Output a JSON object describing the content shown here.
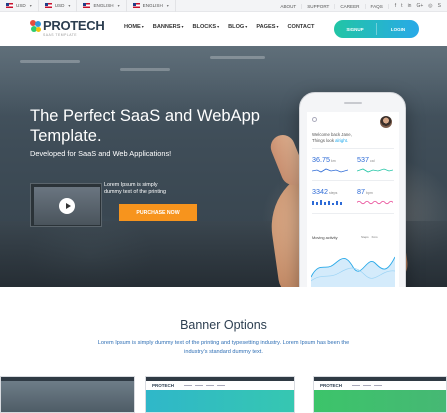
{
  "topbar": {
    "currency1": "USD",
    "currency2": "USD",
    "language1": "ENGLISH",
    "language2": "ENGLISH",
    "links": [
      "ABOUT",
      "SUPPORT",
      "CAREER",
      "FAQS"
    ],
    "social_icons": [
      "facebook-icon",
      "twitter-icon",
      "linkedin-icon",
      "google-plus-icon",
      "instagram-icon",
      "skype-icon"
    ]
  },
  "header": {
    "logo_text": "PROTECH",
    "logo_sub": "SAAS TEMPLATE",
    "nav": [
      {
        "label": "HOME",
        "dropdown": true
      },
      {
        "label": "BANNERS",
        "dropdown": true
      },
      {
        "label": "BLOCKS",
        "dropdown": true
      },
      {
        "label": "BLOG",
        "dropdown": true
      },
      {
        "label": "PAGES",
        "dropdown": true
      },
      {
        "label": "CONTACT",
        "dropdown": false
      }
    ],
    "signup_label": "SIGNUP",
    "login_label": "LOGIN"
  },
  "hero": {
    "title": "The Perfect SaaS and WebApp Template.",
    "subtitle": "Developed for SaaS and Web Applications!",
    "video_text": "Lorem Ipsum is simply dummy text of the printing",
    "purchase_label": "PURCHASE NOW"
  },
  "phone": {
    "welcome_line1": "Welcome back Jane,",
    "welcome_line2_prefix": "Things look ",
    "welcome_highlight": "alright.",
    "stats": [
      {
        "value": "36.75",
        "unit": "km",
        "color": "#2e6bd6"
      },
      {
        "value": "537",
        "unit": "cal",
        "color": "#2e6bd6"
      },
      {
        "value": "3342",
        "unit": "steps",
        "color": "#2e6bd6"
      },
      {
        "value": "87",
        "unit": "bpm",
        "color": "#2e6bd6"
      }
    ],
    "moving_activity_label": "Moving activity",
    "legend": [
      "Steps",
      "Kms"
    ]
  },
  "banner_section": {
    "title": "Banner Options",
    "text": "Lorem Ipsum is simply dummy text of the printing and typesetting industry. Lorem Ipsum has been the industry's standard dummy text."
  },
  "colors": {
    "accent_green": "#21c5a5",
    "accent_blue": "#29a9e8",
    "purchase_orange": "#f7941d",
    "stat_blue": "#2e6bd6"
  }
}
